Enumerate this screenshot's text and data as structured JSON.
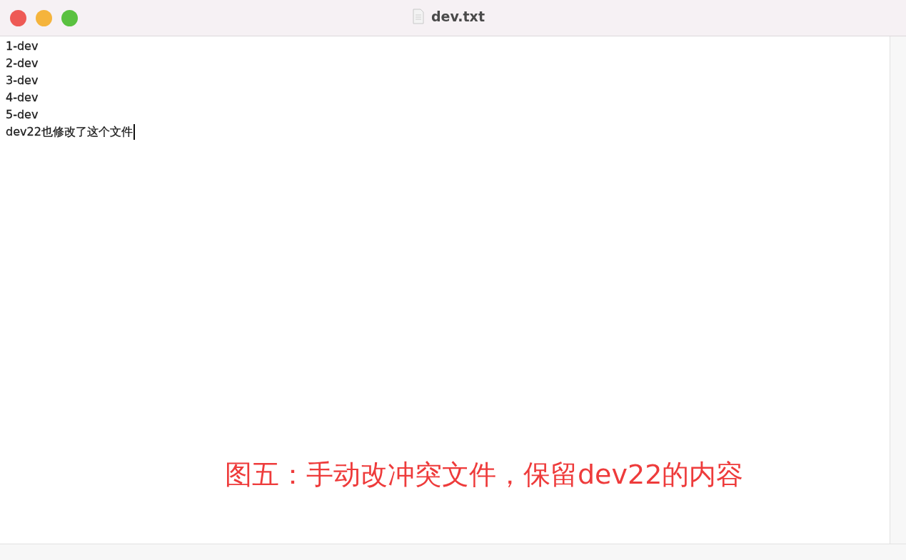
{
  "window": {
    "title": "dev.txt"
  },
  "document": {
    "lines": [
      {
        "text": "1-dev",
        "caret": false
      },
      {
        "text": "2-dev",
        "caret": false
      },
      {
        "text": "3-dev",
        "caret": false
      },
      {
        "text": "4-dev",
        "caret": false
      },
      {
        "text": "5-dev",
        "caret": false
      },
      {
        "text": "dev22也修改了这个文件",
        "caret": true
      }
    ]
  },
  "annotation": {
    "text": "图五：手动改冲突文件，保留dev22的内容"
  }
}
